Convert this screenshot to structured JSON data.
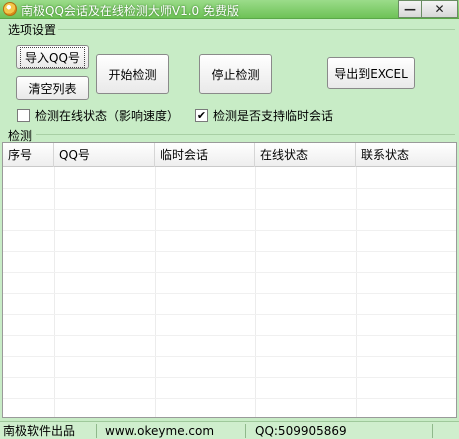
{
  "window": {
    "title": "南极QQ会话及在线检测大师V1.0 免费版",
    "minimize_glyph": "—",
    "close_glyph": "✕"
  },
  "options": {
    "group_label": "选项设置",
    "import_button": "导入QQ号",
    "clear_button": "清空列表",
    "start_button": "开始检测",
    "stop_button": "停止检测",
    "export_button": "导出到EXCEL",
    "check_online_label": "检测在线状态（影响速度）",
    "check_online_checked": false,
    "check_temp_session_label": "检测是否支持临时会话",
    "check_temp_session_checked": true,
    "checkmark_glyph": "✔"
  },
  "detect": {
    "group_label": "检测",
    "columns": [
      "序号",
      "QQ号",
      "临时会话",
      "在线状态",
      "联系状态"
    ],
    "rows": []
  },
  "statusbar": {
    "publisher": "南极软件出品",
    "website": "www.okeyme.com",
    "qq": "QQ:509905869"
  },
  "colors": {
    "background": "#c8ecc6",
    "titlebar": "#6ec257"
  },
  "icons": {
    "app": "qq-penguin-icon"
  }
}
